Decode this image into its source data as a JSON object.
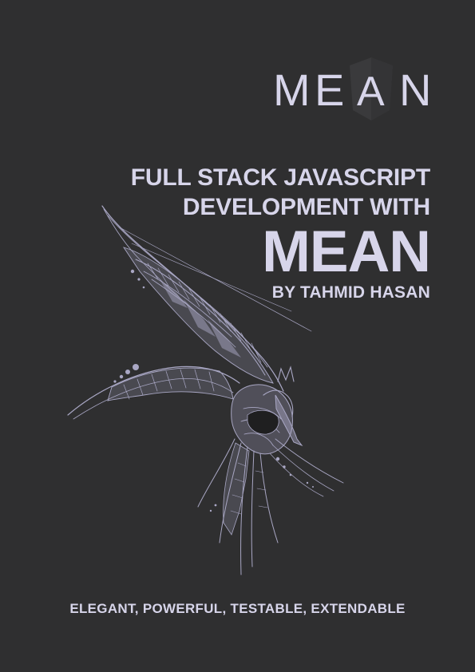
{
  "logo": {
    "letters": [
      "M",
      "E",
      "A",
      "N"
    ],
    "shield_color": "#3a3a3c",
    "text_color": "#d7d5ea"
  },
  "title": {
    "line1": "FULL STACK JAVASCRIPT",
    "line2": "DEVELOPMENT WITH",
    "big": "MEAN"
  },
  "author": "BY TAHMID HASAN",
  "tagline": "ELEGANT, POWERFUL, TESTABLE, EXTENDABLE",
  "colors": {
    "background": "#2f2f30",
    "text": "#d7d5ea",
    "illustration": "#a9a7c4"
  },
  "illustration": "phoenix-bird-illustration"
}
